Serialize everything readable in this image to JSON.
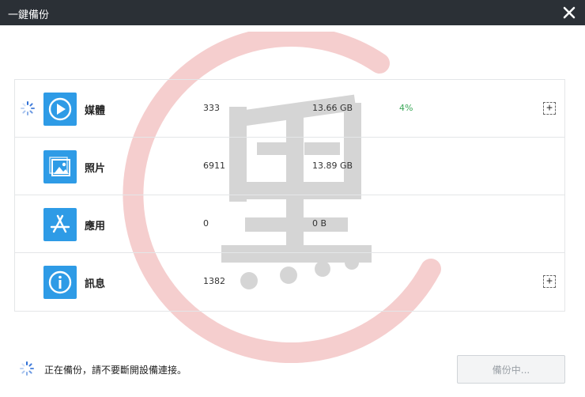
{
  "window": {
    "title": "一鍵備份",
    "close_icon": "close-icon"
  },
  "categories": [
    {
      "name": "媒體",
      "count": "333",
      "size": "13.66 GB",
      "progress": "4%",
      "icon": "play-icon",
      "busy": true,
      "expandable": true
    },
    {
      "name": "照片",
      "count": "6911",
      "size": "13.89 GB",
      "progress": "",
      "icon": "photo-icon",
      "busy": false,
      "expandable": false
    },
    {
      "name": "應用",
      "count": "0",
      "size": "0 B",
      "progress": "",
      "icon": "app-store-icon",
      "busy": false,
      "expandable": false
    },
    {
      "name": "訊息",
      "count": "1382",
      "size": "",
      "progress": "",
      "icon": "info-icon",
      "busy": false,
      "expandable": true
    }
  ],
  "expand_symbol": "+",
  "status": {
    "text": "正在備份，請不要斷開設備連接。"
  },
  "action": {
    "backup_label": "備份中..."
  },
  "colors": {
    "titlebar": "#2b3036",
    "accent": "#2e9be6",
    "progress": "#3aa757",
    "watermark_ring": "#f3c6c6"
  }
}
